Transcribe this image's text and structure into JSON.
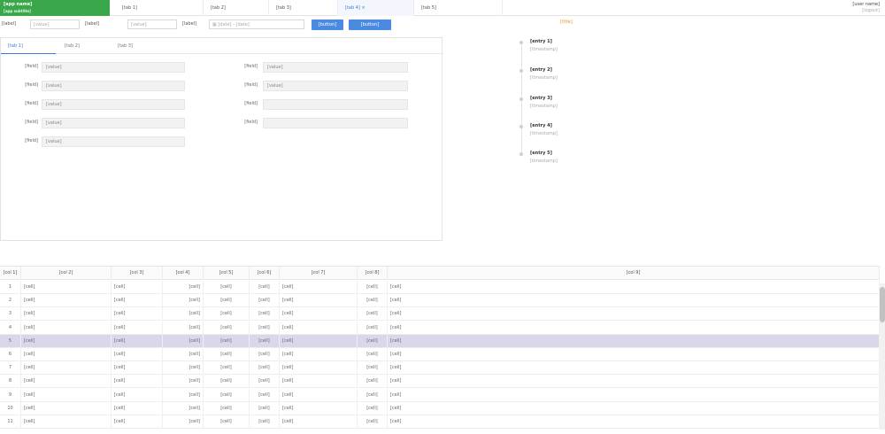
{
  "header": {
    "logo_line1": "[app name]",
    "logo_line2": "[app subtitle]",
    "tabs": [
      {
        "label": "[tab 1]",
        "active": false
      },
      {
        "label": "[tab 2]",
        "active": false
      },
      {
        "label": "[tab 3]",
        "active": false
      },
      {
        "label": "[tab 4]",
        "active": true
      },
      {
        "label": "[tab 5]",
        "active": false
      }
    ],
    "user_name": "[user name]",
    "user_logout": "[logout]"
  },
  "search": {
    "label1": "[label]",
    "value1": "[value]",
    "label2": "[label]",
    "value2": "[value]",
    "label3": "[label]",
    "date_from": "[date]",
    "date_sep": "-",
    "date_to": "[date]",
    "search_btn": "[button]",
    "reset_btn": "[button]"
  },
  "detail": {
    "tabs": [
      "[tab 1]",
      "[tab 2]",
      "[tab 3]"
    ],
    "left_fields": [
      {
        "label": "[field]",
        "value": "[value]"
      },
      {
        "label": "[field]",
        "value": "[value]"
      },
      {
        "label": "[field]",
        "value": "[value]"
      },
      {
        "label": "[field]",
        "value": "[value]"
      },
      {
        "label": "[field]",
        "value": "[value]"
      }
    ],
    "right_fields": [
      {
        "label": "[field]",
        "value": "[value]"
      },
      {
        "label": "[field]",
        "value": "[value]"
      },
      {
        "label": "[field]",
        "value": ""
      },
      {
        "label": "[field]",
        "value": ""
      }
    ]
  },
  "timeline": {
    "title": "[title]",
    "items": [
      {
        "title": "[entry 1]",
        "time": "[timestamp]"
      },
      {
        "title": "[entry 2]",
        "time": "[timestamp]"
      },
      {
        "title": "[entry 3]",
        "time": "[timestamp]"
      },
      {
        "title": "[entry 4]",
        "time": "[timestamp]"
      },
      {
        "title": "[entry 5]",
        "time": "[timestamp]"
      }
    ]
  },
  "table": {
    "columns": [
      "[col 1]",
      "[col 2]",
      "[col 3]",
      "[col 4]",
      "[col 5]",
      "[col 6]",
      "[col 7]",
      "[col 8]",
      "[col 9]"
    ],
    "rows": [
      [
        "1",
        "[cell]",
        "[cell]",
        "[cell]",
        "[cell]",
        "[cell]",
        "[cell]",
        "[cell]",
        "[cell]"
      ],
      [
        "2",
        "[cell]",
        "[cell]",
        "[cell]",
        "[cell]",
        "[cell]",
        "[cell]",
        "[cell]",
        "[cell]"
      ],
      [
        "3",
        "[cell]",
        "[cell]",
        "[cell]",
        "[cell]",
        "[cell]",
        "[cell]",
        "[cell]",
        "[cell]"
      ],
      [
        "4",
        "[cell]",
        "[cell]",
        "[cell]",
        "[cell]",
        "[cell]",
        "[cell]",
        "[cell]",
        "[cell]"
      ],
      [
        "5",
        "[cell]",
        "[cell]",
        "[cell]",
        "[cell]",
        "[cell]",
        "[cell]",
        "[cell]",
        "[cell]"
      ],
      [
        "6",
        "[cell]",
        "[cell]",
        "[cell]",
        "[cell]",
        "[cell]",
        "[cell]",
        "[cell]",
        "[cell]"
      ],
      [
        "7",
        "[cell]",
        "[cell]",
        "[cell]",
        "[cell]",
        "[cell]",
        "[cell]",
        "[cell]",
        "[cell]"
      ],
      [
        "8",
        "[cell]",
        "[cell]",
        "[cell]",
        "[cell]",
        "[cell]",
        "[cell]",
        "[cell]",
        "[cell]"
      ],
      [
        "9",
        "[cell]",
        "[cell]",
        "[cell]",
        "[cell]",
        "[cell]",
        "[cell]",
        "[cell]",
        "[cell]"
      ],
      [
        "10",
        "[cell]",
        "[cell]",
        "[cell]",
        "[cell]",
        "[cell]",
        "[cell]",
        "[cell]",
        "[cell]"
      ],
      [
        "11",
        "[cell]",
        "[cell]",
        "[cell]",
        "[cell]",
        "[cell]",
        "[cell]",
        "[cell]",
        "[cell]"
      ]
    ],
    "selected_row": 4
  },
  "colors": {
    "brand": "#3aa84a",
    "accent": "#4a8ae0",
    "timeline_title": "#f08a2c",
    "selected_row": "#d9d8ea"
  }
}
